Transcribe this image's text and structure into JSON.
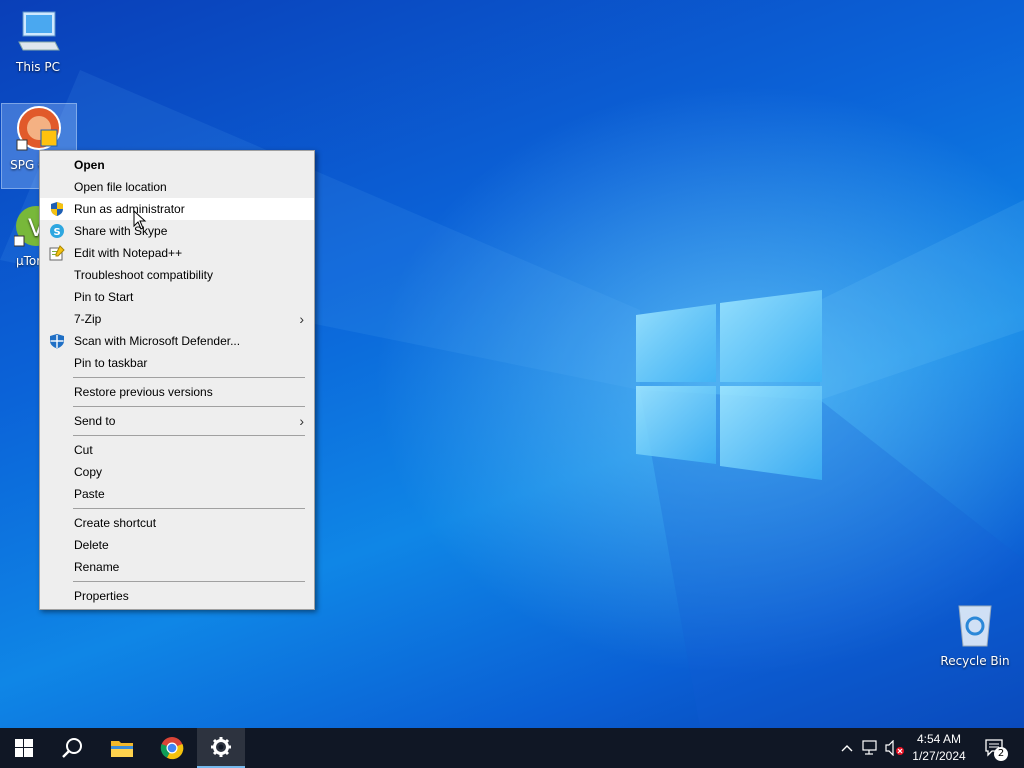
{
  "desktop": {
    "icons": [
      {
        "label": "This PC"
      },
      {
        "label": "SPG Colle"
      },
      {
        "label": "µTor"
      },
      {
        "label": "Recycle Bin"
      }
    ]
  },
  "context_menu": {
    "items": [
      {
        "label": "Open"
      },
      {
        "label": "Open file location"
      },
      {
        "label": "Run as administrator"
      },
      {
        "label": "Share with Skype"
      },
      {
        "label": "Edit with Notepad++"
      },
      {
        "label": "Troubleshoot compatibility"
      },
      {
        "label": "Pin to Start"
      },
      {
        "label": "7-Zip"
      },
      {
        "label": "Scan with Microsoft Defender..."
      },
      {
        "label": "Pin to taskbar"
      },
      {
        "label": "Restore previous versions"
      },
      {
        "label": "Send to"
      },
      {
        "label": "Cut"
      },
      {
        "label": "Copy"
      },
      {
        "label": "Paste"
      },
      {
        "label": "Create shortcut"
      },
      {
        "label": "Delete"
      },
      {
        "label": "Rename"
      },
      {
        "label": "Properties"
      }
    ]
  },
  "taskbar": {
    "clock_time": "4:54 AM",
    "clock_date": "1/27/2024",
    "notification_count": "2"
  },
  "icons": [
    "windows-start-icon",
    "search-icon",
    "file-explorer-icon",
    "chrome-icon",
    "settings-icon",
    "chevron-up-icon",
    "network-icon",
    "volume-muted-icon",
    "notification-icon"
  ],
  "colors": {
    "desktop": "#0b63d8",
    "taskbar": "#101725",
    "menu": "#eeeeee",
    "accent": "#76b9ed"
  }
}
